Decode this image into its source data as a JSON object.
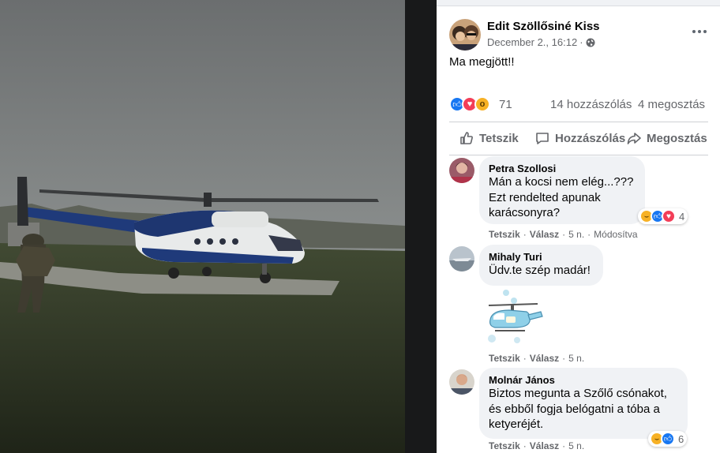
{
  "post": {
    "author": "Edit Szöllősiné Kiss",
    "date": "December 2., 16:12",
    "separator": "·",
    "text": "Ma megjött!!",
    "privacy_icon": "globe-icon",
    "more_icon": "more-horizontal-icon"
  },
  "reactions": {
    "types": [
      "like",
      "love",
      "wow"
    ],
    "count": "71",
    "comments": "14 hozzászólás",
    "shares": "4 megosztás"
  },
  "actions": {
    "like": "Tetszik",
    "comment": "Hozzászólás",
    "share": "Megosztás"
  },
  "comments": [
    {
      "author": "Petra Szollosi",
      "lines": [
        "Mán a kocsi nem elég...???",
        "Ezt rendelted apunak",
        "karácsonyra?"
      ],
      "reactions": [
        "haha",
        "like",
        "love"
      ],
      "reaction_count": "4",
      "like": "Tetszik",
      "reply": "Válasz",
      "time": "5 n.",
      "edited": "Módosítva"
    },
    {
      "author": "Mihaly Turi",
      "lines": [
        "Üdv.te szép madár!"
      ],
      "sticker": "helicopter-sticker",
      "like": "Tetszik",
      "reply": "Válasz",
      "time": "5 n."
    },
    {
      "author": "Molnár János",
      "lines": [
        "Biztos megunta a Szőlő csónakot,",
        "és ebből fogja belógatni a tóba a",
        "ketyeréjét."
      ],
      "reactions": [
        "haha",
        "like"
      ],
      "reaction_count": "6",
      "like": "Tetszik",
      "reply": "Válasz",
      "time": "5 n."
    }
  ],
  "colors": {
    "facebook_blue": "#1877f2",
    "love_red": "#f33e58",
    "wow_yellow": "#f7b125",
    "muted_text": "#65676b",
    "bubble_bg": "#f0f2f5"
  }
}
